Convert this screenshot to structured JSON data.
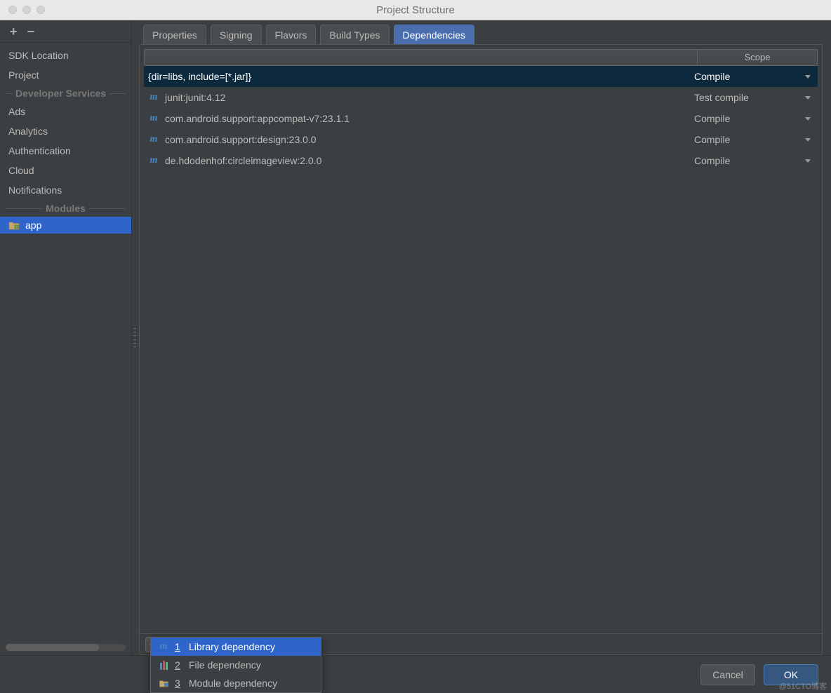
{
  "window_title": "Project Structure",
  "sidebar": {
    "items": [
      {
        "label": "SDK Location"
      },
      {
        "label": "Project"
      }
    ],
    "developer_section": "Developer Services",
    "developer_items": [
      {
        "label": "Ads"
      },
      {
        "label": "Analytics"
      },
      {
        "label": "Authentication"
      },
      {
        "label": "Cloud"
      },
      {
        "label": "Notifications"
      }
    ],
    "modules_section": "Modules",
    "modules": [
      {
        "label": "app",
        "selected": true
      }
    ]
  },
  "tabs": [
    {
      "label": "Properties"
    },
    {
      "label": "Signing"
    },
    {
      "label": "Flavors"
    },
    {
      "label": "Build Types"
    },
    {
      "label": "Dependencies",
      "active": true
    }
  ],
  "table": {
    "scope_header": "Scope",
    "rows": [
      {
        "name": "{dir=libs, include=[*.jar]}",
        "scope": "Compile",
        "icon": "none",
        "selected": true
      },
      {
        "name": "junit:junit:4.12",
        "scope": "Test compile",
        "icon": "m"
      },
      {
        "name": "com.android.support:appcompat-v7:23.1.1",
        "scope": "Compile",
        "icon": "m"
      },
      {
        "name": "com.android.support:design:23.0.0",
        "scope": "Compile",
        "icon": "m"
      },
      {
        "name": "de.hdodenhof:circleimageview:2.0.0",
        "scope": "Compile",
        "icon": "m"
      }
    ]
  },
  "popup": {
    "items": [
      {
        "index": "1",
        "label": "Library dependency",
        "icon": "m",
        "selected": true
      },
      {
        "index": "2",
        "label": "File dependency",
        "icon": "books"
      },
      {
        "index": "3",
        "label": "Module dependency",
        "icon": "folder"
      }
    ]
  },
  "footer": {
    "cancel": "Cancel",
    "ok": "OK"
  },
  "watermark": "@51CTO博客"
}
